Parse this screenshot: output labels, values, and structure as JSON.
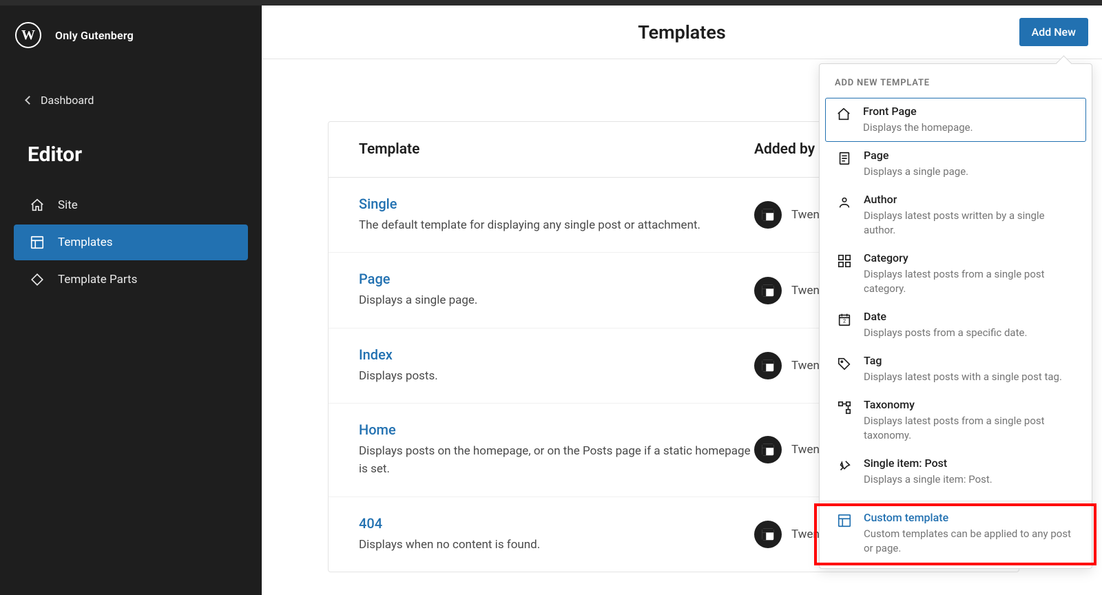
{
  "site_title": "Only Gutenberg",
  "back_label": "Dashboard",
  "editor_label": "Editor",
  "nav": [
    {
      "label": "Site"
    },
    {
      "label": "Templates"
    },
    {
      "label": "Template Parts"
    }
  ],
  "page_title": "Templates",
  "add_new_label": "Add New",
  "table": {
    "headers": {
      "template": "Template",
      "added_by": "Added by"
    },
    "rows": [
      {
        "name": "Single",
        "desc": "The default template for displaying any single post or attachment.",
        "added_by": "Twenty Twenty-Three"
      },
      {
        "name": "Page",
        "desc": "Displays a single page.",
        "added_by": "Twenty Twenty-Three"
      },
      {
        "name": "Index",
        "desc": "Displays posts.",
        "added_by": "Twenty Twenty-Three"
      },
      {
        "name": "Home",
        "desc": "Displays posts on the homepage, or on the Posts page if a static homepage is set.",
        "added_by": "Twenty Twenty-Three"
      },
      {
        "name": "404",
        "desc": "Displays when no content is found.",
        "added_by": "Twenty Twenty-Three"
      }
    ]
  },
  "dropdown": {
    "header": "ADD NEW TEMPLATE",
    "items": [
      {
        "title": "Front Page",
        "desc": "Displays the homepage."
      },
      {
        "title": "Page",
        "desc": "Displays a single page."
      },
      {
        "title": "Author",
        "desc": "Displays latest posts written by a single author."
      },
      {
        "title": "Category",
        "desc": "Displays latest posts from a single post category."
      },
      {
        "title": "Date",
        "desc": "Displays posts from a specific date."
      },
      {
        "title": "Tag",
        "desc": "Displays latest posts with a single post tag."
      },
      {
        "title": "Taxonomy",
        "desc": "Displays latest posts from a single post taxonomy."
      },
      {
        "title": "Single item: Post",
        "desc": "Displays a single item: Post."
      }
    ],
    "custom": {
      "title": "Custom template",
      "desc": "Custom templates can be applied to any post or page."
    }
  }
}
